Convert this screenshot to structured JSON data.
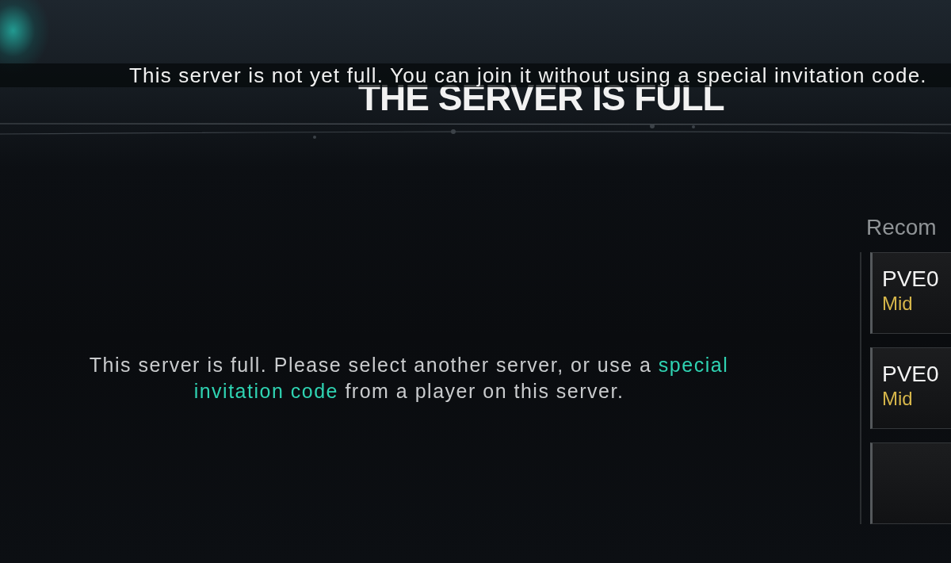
{
  "tooltip": {
    "text": "This server is not yet full. You can join it without using a special invitation code."
  },
  "title": "THE SERVER IS FULL",
  "message": {
    "parts": [
      {
        "kind": "plain",
        "text": "This server is full. Please select another server, or use a "
      },
      {
        "kind": "highlight",
        "text": "special invitation code"
      },
      {
        "kind": "plain",
        "text": " from a player on this server."
      }
    ]
  },
  "recommended": {
    "heading": "Recom",
    "servers": [
      {
        "kind": "server",
        "name": "PVE0",
        "difficulty": "Mid"
      },
      {
        "kind": "server",
        "name": "PVE0",
        "difficulty": "Mid"
      },
      {
        "kind": "empty"
      }
    ]
  }
}
